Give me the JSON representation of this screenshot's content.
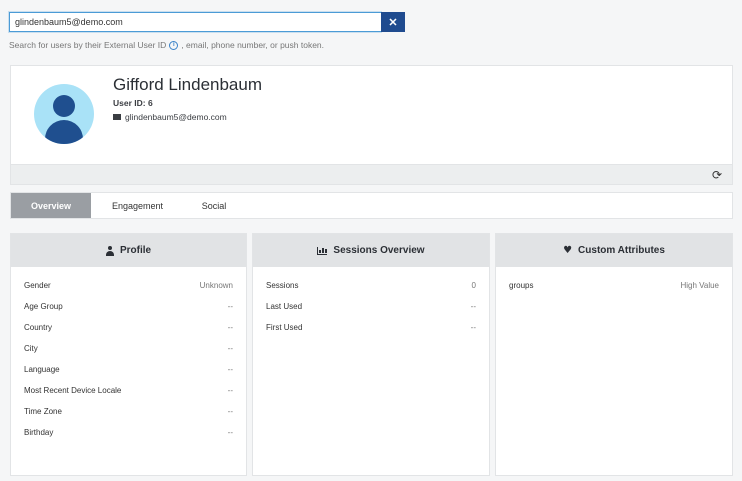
{
  "search": {
    "value": "glindenbaum5@demo.com",
    "clear_label": "✕",
    "helper_before": "Search for users by their External User ID",
    "helper_after": ", email, phone number, or push token."
  },
  "user": {
    "name": "Gifford Lindenbaum",
    "id_line": "User ID: 6",
    "email": "glindenbaum5@demo.com"
  },
  "tabs": [
    {
      "label": "Overview",
      "active": true
    },
    {
      "label": "Engagement",
      "active": false
    },
    {
      "label": "Social",
      "active": false
    }
  ],
  "panels": {
    "profile": {
      "title": "Profile",
      "rows": [
        {
          "label": "Gender",
          "value": "Unknown"
        },
        {
          "label": "Age Group",
          "value": "--"
        },
        {
          "label": "Country",
          "value": "--"
        },
        {
          "label": "City",
          "value": "--"
        },
        {
          "label": "Language",
          "value": "--"
        },
        {
          "label": "Most Recent Device Locale",
          "value": "--"
        },
        {
          "label": "Time Zone",
          "value": "--"
        },
        {
          "label": "Birthday",
          "value": "--"
        }
      ]
    },
    "sessions": {
      "title": "Sessions Overview",
      "rows": [
        {
          "label": "Sessions",
          "value": "0"
        },
        {
          "label": "Last Used",
          "value": "--"
        },
        {
          "label": "First Used",
          "value": "--"
        }
      ]
    },
    "custom": {
      "title": "Custom Attributes",
      "rows": [
        {
          "label": "groups",
          "value": "High Value"
        }
      ]
    }
  },
  "colors": {
    "accent": "#1f4b8f",
    "avatar_bg": "#a9e2f7",
    "active_tab": "#9a9ea3"
  }
}
